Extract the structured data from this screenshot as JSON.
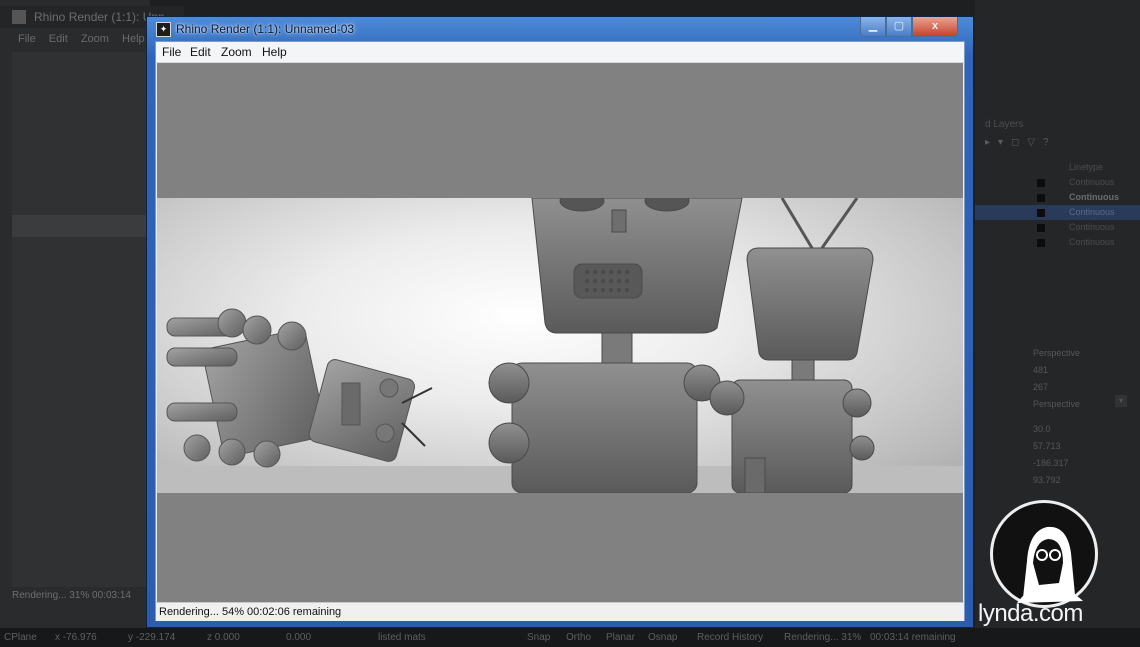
{
  "background": {
    "left_window_title": "Rhino Render (1:1): Unn",
    "left_menu": [
      "File",
      "Edit",
      "Zoom",
      "Help"
    ],
    "left_status": "Rendering... 31%     00:03:14",
    "layers_header": "d Layers",
    "layers_col": "Linetype",
    "layers": [
      "Continuous",
      "Continuous",
      "Continuous",
      "Continuous",
      "Continuous"
    ],
    "props": [
      "Perspective",
      "481",
      "267",
      "Perspective",
      "30.0",
      "57.713",
      "-186.317",
      "93.792"
    ],
    "status_items": [
      "CPlane",
      "x -76.976",
      "y -229.174",
      "z 0.000",
      "0.000",
      "listed mats",
      "Snap",
      "Ortho",
      "Planar",
      "Osnap",
      "Record History",
      "Rendering... 31%",
      "00:03:14 remaining"
    ]
  },
  "window": {
    "title": "Rhino Render (1:1): Unnamed-03",
    "controls": [
      "min",
      "max",
      "close"
    ],
    "close_symbol": "x",
    "menu": [
      {
        "label": "File"
      },
      {
        "label": "Edit"
      },
      {
        "label": "Zoom"
      },
      {
        "label": "Help"
      }
    ],
    "status": {
      "progress_text": "Rendering... 54%",
      "remaining_text": "00:02:06 remaining",
      "progress": 0.54
    }
  },
  "watermark": {
    "brand": "lynda.com"
  },
  "colors": {
    "titlebar": "#2f64b8",
    "viewport": "#818181",
    "close_button": "#c6422c"
  }
}
